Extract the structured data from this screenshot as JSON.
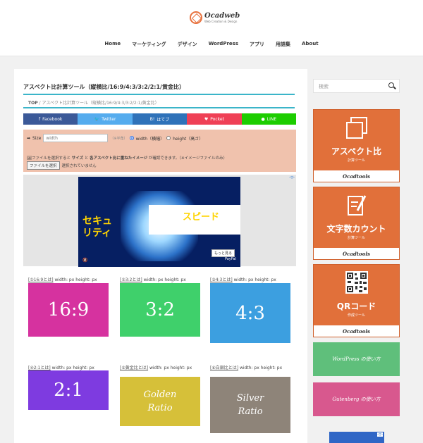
{
  "site": {
    "name": "Ocadweb",
    "tagline": "Web Creation & Design"
  },
  "nav": [
    "Home",
    "マーケティング",
    "デザイン",
    "WordPress",
    "アプリ",
    "用語集",
    "About"
  ],
  "page": {
    "title": "アスペクト比計算ツール（縦横比/16:9/4:3/3:2/2:1/黄金比）",
    "breadcrumb_home": "TOP",
    "breadcrumb_sep": "/",
    "breadcrumb_current": "アスペクト比計算ツール（縦横比/16:9/4:3/3:2/2:1/黄金比）"
  },
  "share": [
    {
      "label": "Facebook",
      "icon": "f",
      "color": "#3b5998"
    },
    {
      "label": "Twitter",
      "icon": "🐦",
      "color": "#55acee"
    },
    {
      "label": "はてブ",
      "icon": "B!",
      "color": "#2f72b9"
    },
    {
      "label": "Pocket",
      "icon": "♥",
      "color": "#ef4056"
    },
    {
      "label": "LINE",
      "icon": "●",
      "color": "#1dcd00"
    }
  ],
  "tool": {
    "size_label": "Size",
    "size_placeholder": "width",
    "size_note": "（※半角）",
    "opt_width": "width（横幅）",
    "opt_height": "height（高さ）",
    "file_note_pre": "ファイルを選択すると ",
    "file_note_b1": "サイズ",
    "file_note_mid": " と ",
    "file_note_b2": "各アスペクト比に重ねたイメージ",
    "file_note_post": " が確認できます。（※イメージファイルのみ）",
    "file_button": "ファイルを選択",
    "file_status": "選択されていません"
  },
  "ad": {
    "corner": "◁▷",
    "headline": "スピード",
    "copy_line1": "セキュ",
    "copy_line2": "リティ",
    "button": "もっと見る",
    "brand": "PayPal",
    "mute": "🔇"
  },
  "cards": [
    {
      "link": "[①16:9とは]",
      "info": " width: px   height: px",
      "text": "16:9",
      "color": "#d6329f"
    },
    {
      "link": "[②3:2とは]",
      "info": " width: px   height: px",
      "text": "3:2",
      "color": "#3fd06b"
    },
    {
      "link": "[③4:3とは]",
      "info": " width: px   height: px",
      "text": "4:3",
      "color": "#3c9fe0"
    },
    {
      "link": "[④2:1とは]",
      "info": " width: px   height: px",
      "text": "2:1",
      "color": "#7e3be0"
    },
    {
      "link": "[⑤黄金比とは]",
      "info": " width: px   height: px",
      "text": "Golden Ratio",
      "color": "#d6c039"
    },
    {
      "link": "[⑥白銀比とは]",
      "info": " width: px   height: px",
      "text": "Silver Ratio",
      "color": "#8e8479"
    }
  ],
  "sidebar": {
    "search_placeholder": "検索",
    "tools": [
      {
        "title": "アスペクト比",
        "sub": "計算ツール",
        "brand": "Ocadtools",
        "icon": "stacked-rect-icon"
      },
      {
        "title": "文字数カウント",
        "sub": "計算ツール",
        "brand": "Ocadtools",
        "icon": "pencil-paper-icon"
      },
      {
        "title": "QRコード",
        "sub": "作成ツール",
        "brand": "Ocadtools",
        "icon": "qr-icon"
      }
    ],
    "guides": [
      {
        "label": "WordPress の使い方",
        "color": "#5fbf7b"
      },
      {
        "label": "Gutenberg の使い方",
        "color": "#d8588e"
      }
    ]
  }
}
